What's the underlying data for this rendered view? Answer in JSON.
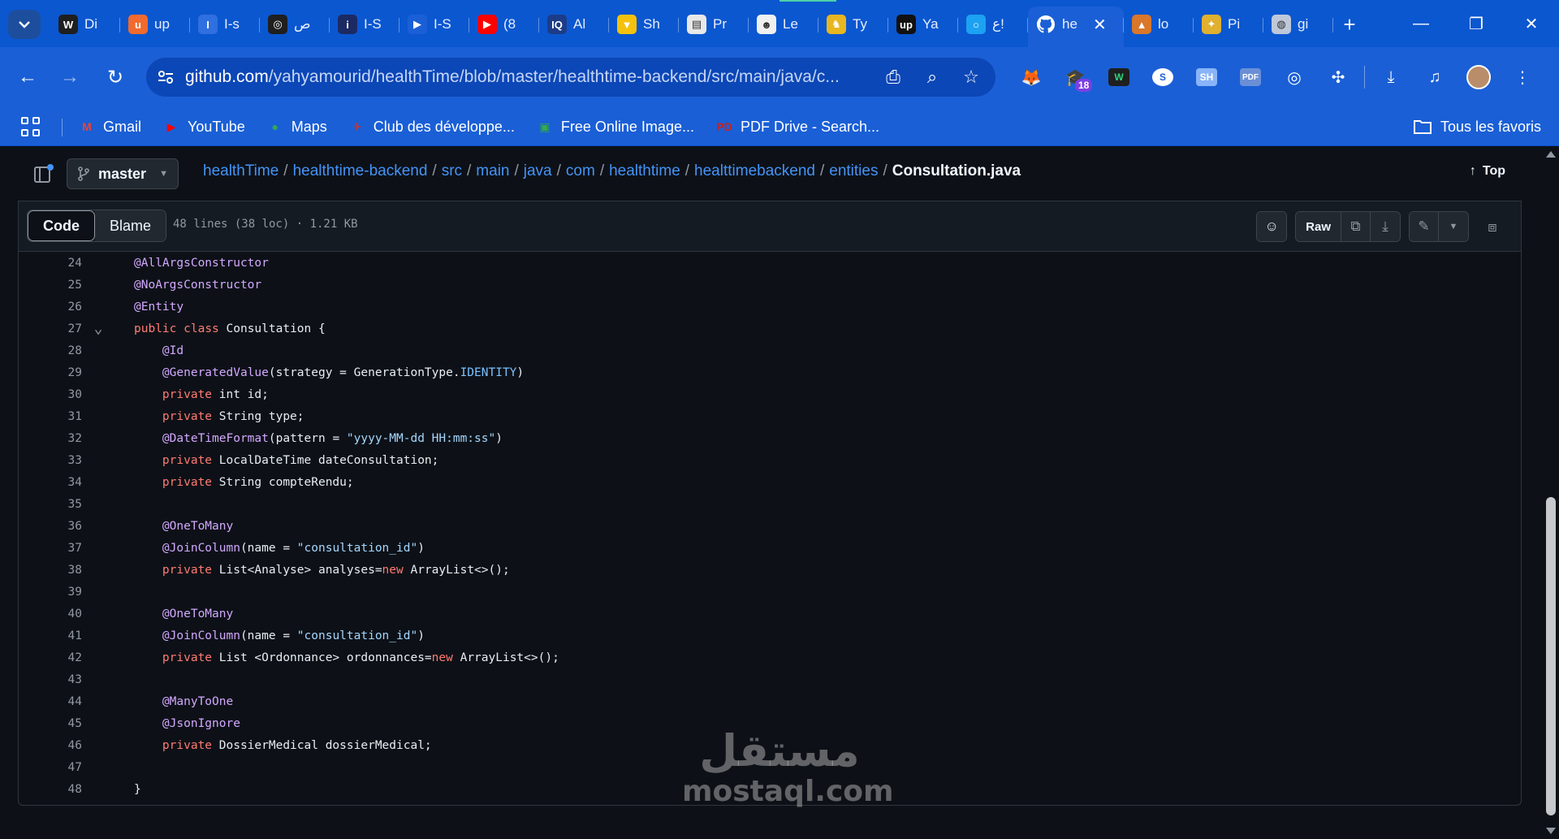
{
  "browser": {
    "tabs": [
      {
        "title": "Di",
        "icon": "wix-icon",
        "color": "#1f1f1f",
        "glyph": "W"
      },
      {
        "title": "up",
        "icon": "orange-app-icon",
        "color": "#f26a2e",
        "glyph": "u"
      },
      {
        "title": "I-s",
        "icon": "blue-app-icon",
        "color": "#2f6fe0",
        "glyph": "I"
      },
      {
        "title": "ص",
        "icon": "openai-icon",
        "color": "#1f1f1f",
        "glyph": "◎"
      },
      {
        "title": "I-S",
        "icon": "lamp-icon",
        "color": "#1c2a63",
        "glyph": "i"
      },
      {
        "title": "I-S",
        "icon": "play-icon",
        "color": "#1a5fd6",
        "glyph": "▶"
      },
      {
        "title": "(8",
        "icon": "youtube-icon",
        "color": "#ff0000",
        "glyph": "▶"
      },
      {
        "title": "Al",
        "icon": "iq-icon",
        "color": "#1c3c88",
        "glyph": "IQ"
      },
      {
        "title": "Sh",
        "icon": "triangle-app-icon",
        "color": "#f4c20d",
        "glyph": "▼"
      },
      {
        "title": "Pr",
        "icon": "document-icon",
        "color": "#e8e8e8",
        "glyph": "▤"
      },
      {
        "title": "Le",
        "icon": "ninja-icon",
        "color": "#f0f0f0",
        "glyph": "☻"
      },
      {
        "title": "Ty",
        "icon": "cat-icon",
        "color": "#e8b620",
        "glyph": "♞"
      },
      {
        "title": "Ya",
        "icon": "upwork-icon",
        "color": "#111111",
        "glyph": "up"
      },
      {
        "title": "ع!",
        "icon": "circle-app-icon",
        "color": "#1da1f2",
        "glyph": "○"
      },
      {
        "title": "he",
        "icon": "github-icon",
        "color": "#1a5fd6",
        "glyph": "",
        "active": true
      },
      {
        "title": "lo",
        "icon": "bars-app-icon",
        "color": "#d9772b",
        "glyph": "▲"
      },
      {
        "title": "Pi",
        "icon": "figure-icon",
        "color": "#e0b030",
        "glyph": "✦"
      },
      {
        "title": "gi",
        "icon": "globe-icon",
        "color": "#bfc8d8",
        "glyph": "◍"
      }
    ],
    "url_host": "github.com",
    "url_path": "/yahyamourid/healthTime/blob/master/healthtime-backend/src/main/java/c...",
    "extension_badge": "18",
    "bookmarks": [
      {
        "label": "Gmail",
        "icon": "gmail-icon",
        "color": "#ea4335",
        "glyph": "M"
      },
      {
        "label": "YouTube",
        "icon": "youtube-icon",
        "color": "#ff0000",
        "glyph": "▶"
      },
      {
        "label": "Maps",
        "icon": "maps-pin-icon",
        "color": "#34a853",
        "glyph": "●"
      },
      {
        "label": "Club des développe...",
        "icon": "runner-icon",
        "color": "#d93025",
        "glyph": "✈"
      },
      {
        "label": "Free Online Image...",
        "icon": "image-icon",
        "color": "#34a853",
        "glyph": "▣"
      },
      {
        "label": "PDF Drive - Search...",
        "icon": "pdf-drive-icon",
        "color": "#c5221f",
        "glyph": "PD"
      }
    ],
    "all_bookmarks_label": "Tous les favoris"
  },
  "repo": {
    "branch": "master",
    "breadcrumb": [
      "healthTime",
      "healthtime-backend",
      "src",
      "main",
      "java",
      "com",
      "healthtime",
      "healttimebackend",
      "entities"
    ],
    "current_file": "Consultation.java",
    "top_label": "Top"
  },
  "file": {
    "tab_code": "Code",
    "tab_blame": "Blame",
    "meta": "48 lines (38 loc) · 1.21 KB",
    "raw_label": "Raw"
  },
  "code_lines": [
    {
      "n": "24",
      "html": "<span class='tk-ann'>@AllArgsConstructor</span>"
    },
    {
      "n": "25",
      "html": "<span class='tk-ann'>@NoArgsConstructor</span>"
    },
    {
      "n": "26",
      "html": "<span class='tk-ann'>@Entity</span>"
    },
    {
      "n": "27",
      "fold": true,
      "html": "<span class='tk-kw'>public</span> <span class='tk-kw'>class</span> Consultation {"
    },
    {
      "n": "28",
      "html": "    <span class='tk-ann'>@Id</span>"
    },
    {
      "n": "29",
      "html": "    <span class='tk-ann'>@GeneratedValue</span>(strategy = GenerationType.<span class='tk-const'>IDENTITY</span>)"
    },
    {
      "n": "30",
      "html": "    <span class='tk-kw'>private</span> int id;"
    },
    {
      "n": "31",
      "html": "    <span class='tk-kw'>private</span> String type;"
    },
    {
      "n": "32",
      "html": "    <span class='tk-ann'>@DateTimeFormat</span>(pattern = <span class='tk-str'>\"yyyy-MM-dd HH:mm:ss\"</span>)"
    },
    {
      "n": "33",
      "html": "    <span class='tk-kw'>private</span> LocalDateTime dateConsultation;"
    },
    {
      "n": "34",
      "html": "    <span class='tk-kw'>private</span> String compteRendu;"
    },
    {
      "n": "35",
      "html": ""
    },
    {
      "n": "36",
      "html": "    <span class='tk-ann'>@OneToMany</span>"
    },
    {
      "n": "37",
      "html": "    <span class='tk-ann'>@JoinColumn</span>(name = <span class='tk-str'>\"consultation_id\"</span>)"
    },
    {
      "n": "38",
      "html": "    <span class='tk-kw'>private</span> List&lt;Analyse&gt; analyses=<span class='tk-kw'>new</span> ArrayList&lt;&gt;();"
    },
    {
      "n": "39",
      "html": ""
    },
    {
      "n": "40",
      "html": "    <span class='tk-ann'>@OneToMany</span>"
    },
    {
      "n": "41",
      "html": "    <span class='tk-ann'>@JoinColumn</span>(name = <span class='tk-str'>\"consultation_id\"</span>)"
    },
    {
      "n": "42",
      "html": "    <span class='tk-kw'>private</span> List &lt;Ordonnance&gt; ordonnances=<span class='tk-kw'>new</span> ArrayList&lt;&gt;();"
    },
    {
      "n": "43",
      "html": ""
    },
    {
      "n": "44",
      "html": "    <span class='tk-ann'>@ManyToOne</span>"
    },
    {
      "n": "45",
      "html": "    <span class='tk-ann'>@JsonIgnore</span>"
    },
    {
      "n": "46",
      "html": "    <span class='tk-kw'>private</span> DossierMedical dossierMedical;"
    },
    {
      "n": "47",
      "html": ""
    },
    {
      "n": "48",
      "html": "}"
    }
  ],
  "watermark": {
    "arabic": "مستقل",
    "latin": "mostaql.com"
  }
}
